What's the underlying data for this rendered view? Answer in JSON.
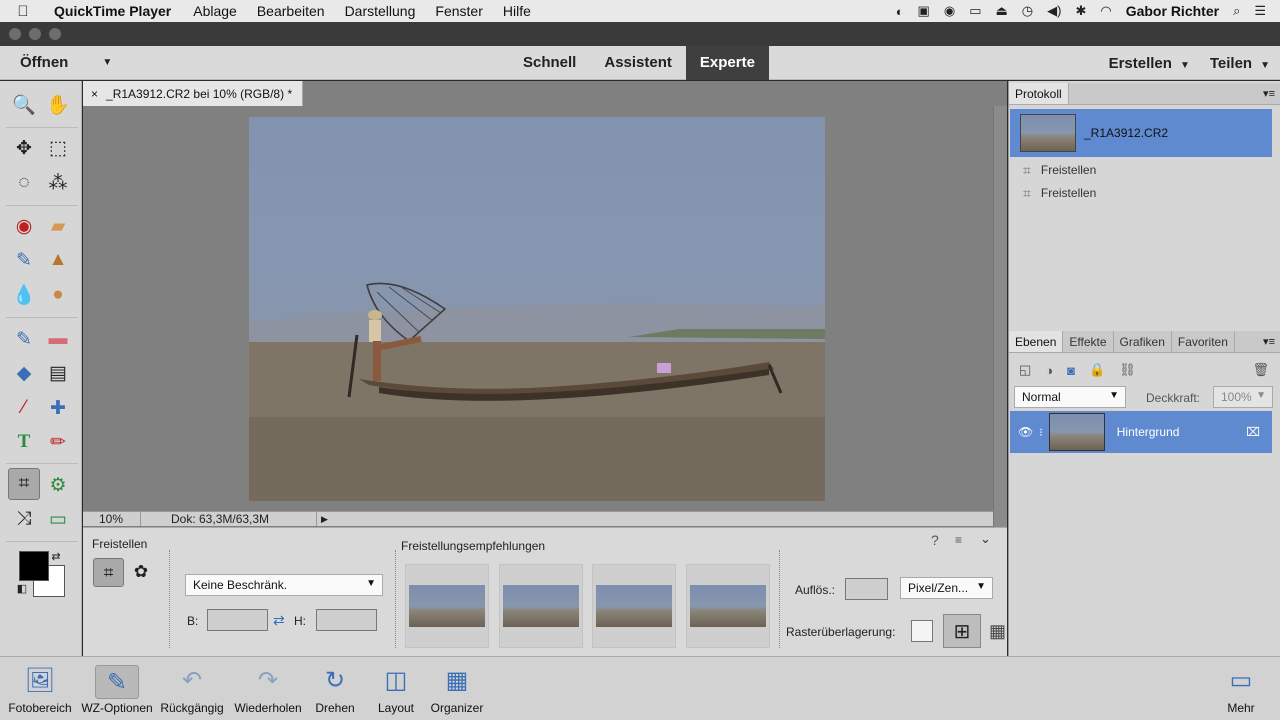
{
  "menubar": {
    "app": "QuickTime Player",
    "items": [
      "Ablage",
      "Bearbeiten",
      "Darstellung",
      "Fenster",
      "Hilfe"
    ],
    "user": "Gabor Richter"
  },
  "topbar": {
    "open": "Öffnen",
    "modes": [
      "Schnell",
      "Assistent",
      "Experte"
    ],
    "active_mode": "Experte",
    "create": "Erstellen",
    "share": "Teilen"
  },
  "document": {
    "tab_close": "×",
    "tab_title": "_R1A3912.CR2 bei 10% (RGB/8) *",
    "zoom": "10%",
    "doc_size": "Dok: 63,3M/63,3M"
  },
  "options": {
    "tool_title": "Freistellen",
    "recommendations_title": "Freistellungsempfehlungen",
    "constraint": "Keine Beschränk.",
    "width_label": "B:",
    "height_label": "H:",
    "resolution_label": "Auflös.:",
    "unit": "Pixel/Zen...",
    "grid_overlay_label": "Rasterüberlagerung:"
  },
  "history": {
    "tab": "Protokoll",
    "selected": "_R1A3912.CR2",
    "steps": [
      "Freistellen",
      "Freistellen"
    ]
  },
  "layers": {
    "tabs": [
      "Ebenen",
      "Effekte",
      "Grafiken",
      "Favoriten"
    ],
    "blend_mode": "Normal",
    "opacity_label": "Deckkraft:",
    "opacity_value": "100%",
    "layer_name": "Hintergrund"
  },
  "bottombar": {
    "photo_bin": "Fotobereich",
    "tool_options": "WZ-Optionen",
    "undo": "Rückgängig",
    "redo": "Wiederholen",
    "rotate": "Drehen",
    "layout": "Layout",
    "organizer": "Organizer",
    "more": "Mehr"
  },
  "colors": {
    "accent": "#5f8ad0",
    "active_mode_bg": "#3f3f3f",
    "icon_blue": "#3a6fb8"
  }
}
